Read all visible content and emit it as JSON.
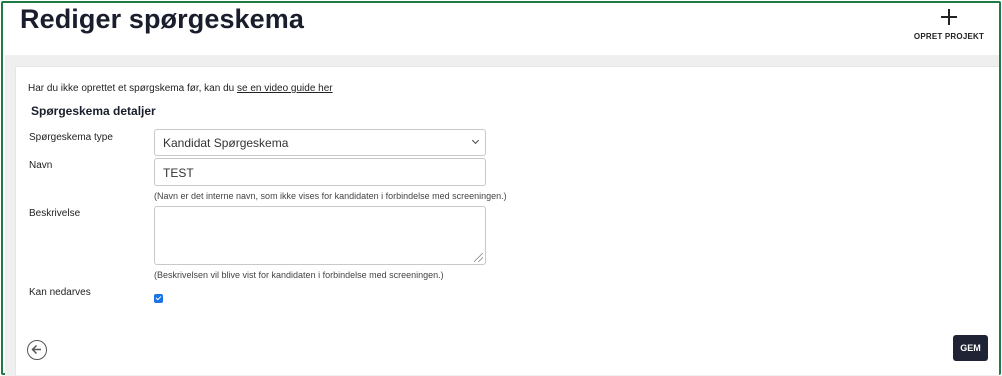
{
  "header": {
    "title": "Rediger spørgeskema",
    "create_project_label": "OPRET PROJEKT"
  },
  "form": {
    "guide_prefix": "Har du ikke oprettet et spørgskema før, kan du ",
    "guide_link": "se en video guide her",
    "section_title": "Spørgeskema detaljer",
    "type_label": "Spørgeskema type",
    "type_value": "Kandidat Spørgeskema",
    "name_label": "Navn",
    "name_value": "TEST",
    "name_help": "(Navn er det interne navn, som ikke vises for kandidaten i forbindelse med screeningen.)",
    "description_label": "Beskrivelse",
    "description_value": "",
    "description_help": "(Beskrivelsen vil blive vist for kandidaten i forbindelse med screeningen.)",
    "inherit_label": "Kan nedarves",
    "inherit_checked": true
  },
  "footer": {
    "save_label": "GEM"
  },
  "icons": {
    "create": "plus-icon",
    "back": "arrow-left-circle-icon",
    "select": "chevron-down-icon"
  },
  "colors": {
    "frame": "#1f7a46",
    "save_button": "#1f2333",
    "checkbox": "#1a73e8"
  }
}
